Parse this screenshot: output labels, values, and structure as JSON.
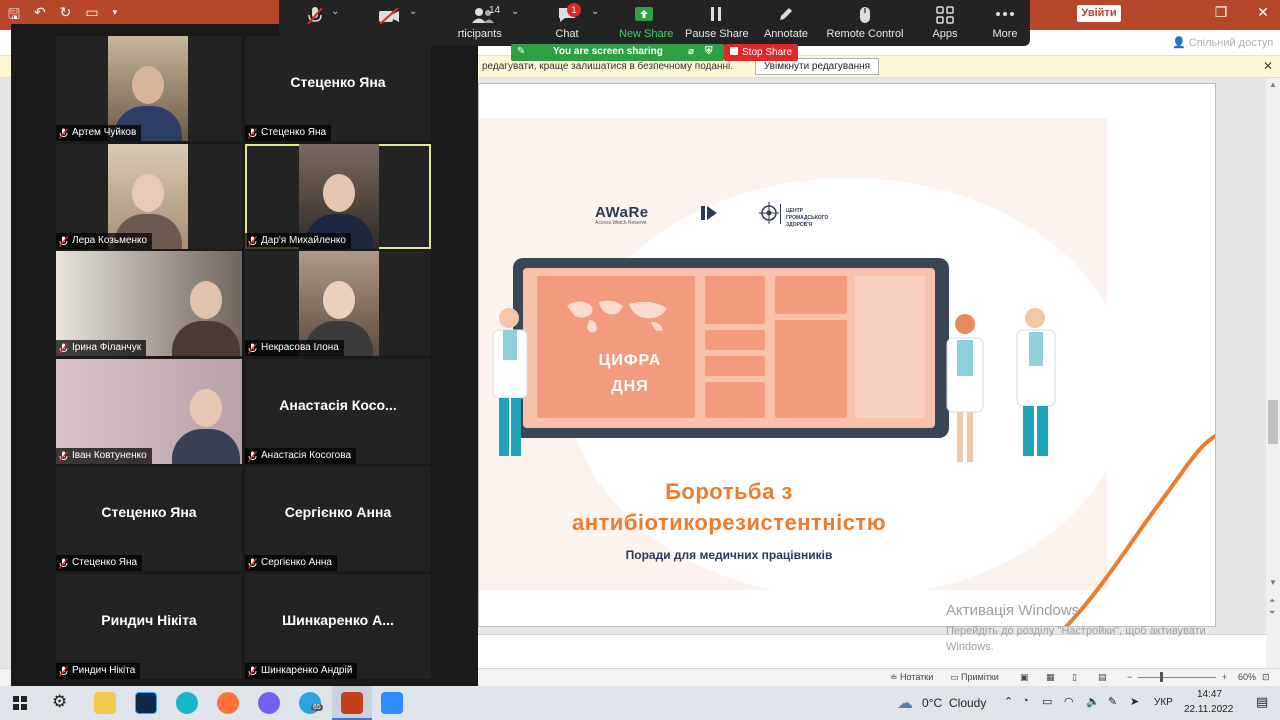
{
  "ppt": {
    "signin_label": "Увійти",
    "share_label": "Спільний доступ",
    "infobar_text": "редагувати, краще залишатися в безпечному поданні.",
    "infobar_button": "Увімкнути редагування",
    "infobar_close": "✕"
  },
  "statusbar": {
    "notes": "Нотатки",
    "comments": "Примітки",
    "zoom_minus": "−",
    "zoom_plus": "+",
    "zoom_value": "60%"
  },
  "slide": {
    "logo_a": "AWaRe",
    "logo_a_sub": "Access Watch Reserve",
    "logo_b": "ЦЕНТР ГРОМАДСЬКОГО ЗДОРОВ'Я",
    "day_line1": "ЦИФРА",
    "day_line2": "ДНЯ",
    "title_line1": "Боротьба з",
    "title_line2": "антибіотикорезистентністю",
    "subtitle": "Поради для медичних працівників"
  },
  "activation": {
    "title": "Активація Windows",
    "text": "Перейдіть до розділу \"Настройки\", щоб активувати Windows."
  },
  "zoom_toolbar": {
    "participants_count": "14",
    "participants_label": "Participants",
    "chat_label": "Chat",
    "chat_badge": "1",
    "new_share_label": "New Share",
    "pause_share_label": "Pause Share",
    "annotate_label": "Annotate",
    "remote_control_label": "Remote Control",
    "apps_label": "Apps",
    "more_label": "More",
    "sharing_text": "You are screen sharing",
    "stop_share_label": "Stop Share",
    "accent_green": "#2ea043",
    "accent_red": "#e02828"
  },
  "gallery": {
    "tiles": [
      {
        "label": "Артем Чуйков",
        "big": ""
      },
      {
        "label": "Стеценко Яна",
        "big": "Стеценко Яна"
      },
      {
        "label": "Лера Козьменко",
        "big": ""
      },
      {
        "label": "Дар'я Михайленко",
        "big": ""
      },
      {
        "label": "Ірина Філанчук",
        "big": ""
      },
      {
        "label": "Некрасова Ілона",
        "big": ""
      },
      {
        "label": "Іван Ковтуненко",
        "big": ""
      },
      {
        "label": "Анастасія Косогова",
        "big": "Анастасія Косо..."
      },
      {
        "label": "Стеценко Яна",
        "big": "Стеценко Яна"
      },
      {
        "label": "Сергієнко Анна",
        "big": "Сергієнко Анна"
      },
      {
        "label": "Риндич Нікіта",
        "big": "Риндич Нікіта"
      },
      {
        "label": "Шинкаренко Андрій",
        "big": "Шинкаренко А..."
      }
    ]
  },
  "taskbar": {
    "telegram_badge": "65",
    "weather_temp": "0°C",
    "weather_text": "Cloudy",
    "language": "УКР",
    "time": "14:47",
    "date": "22.11.2022"
  }
}
